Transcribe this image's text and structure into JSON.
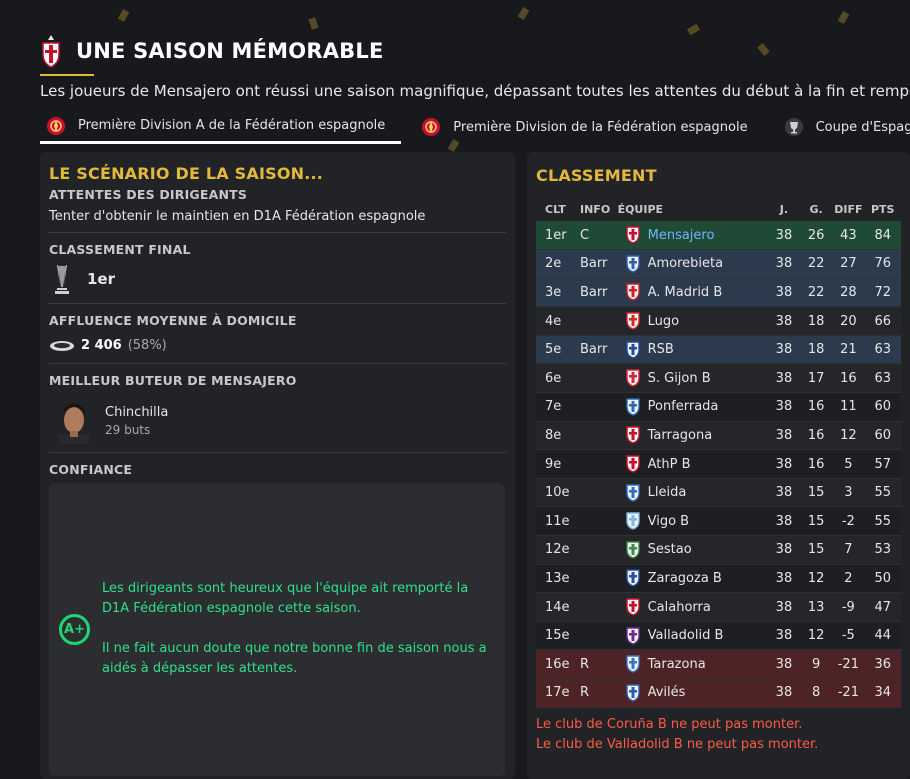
{
  "header": {
    "title": "UNE SAISON MÉMORABLE",
    "subtitle": "Les joueurs de Mensajero ont réussi une saison magnifique, dépassant toutes les attentes du début à la fin et remporté"
  },
  "tabs": [
    {
      "label": "Première Division A de la Fédération espagnole",
      "icon": "league-badge-icon",
      "active": true
    },
    {
      "label": "Première Division de la Fédération espagnole",
      "icon": "league-badge-icon",
      "active": false
    },
    {
      "label": "Coupe d'Espagne",
      "icon": "cup-icon",
      "active": false
    }
  ],
  "scenario": {
    "title": "LE SCÉNARIO DE LA SAISON...",
    "target_label": "ATTENTES DES DIRIGEANTS",
    "target_value": "Tenter d'obtenir le maintien en D1A Fédération espagnole",
    "final_label": "CLASSEMENT FINAL",
    "final_value": "1er",
    "attendance_label": "AFFLUENCE MOYENNE À DOMICILE",
    "attendance_value": "2 406",
    "attendance_pct": "(58%)",
    "scorer_label": "MEILLEUR BUTEUR DE MENSAJERO",
    "scorer_name": "Chinchilla",
    "scorer_goals": "29 buts",
    "confidence_label": "CONFIANCE",
    "confidence_grade": "A+",
    "confidence_text_1": "Les dirigeants sont heureux que l'équipe ait remporté la D1A Fédération espagnole cette saison.",
    "confidence_text_2": "Il ne fait aucun doute que notre bonne fin de saison nous a aidés à dépasser les attentes."
  },
  "standings": {
    "title": "CLASSEMENT",
    "columns": {
      "pos": "CLT",
      "info": "INFO",
      "team": "ÉQUIPE",
      "played": "J.",
      "goals": "G.",
      "diff": "DIFF",
      "pts": "PTS"
    },
    "rows": [
      {
        "pos": "1er",
        "info": "C",
        "team": "Mensajero",
        "played": "38",
        "won": "26",
        "diff": "43",
        "pts": "84",
        "style": "champ",
        "crest_color": "#c8102e",
        "me": true
      },
      {
        "pos": "2e",
        "info": "Barr",
        "team": "Amorebieta",
        "played": "38",
        "won": "22",
        "diff": "27",
        "pts": "76",
        "style": "promo",
        "crest_color": "#2e5fb3"
      },
      {
        "pos": "3e",
        "info": "Barr",
        "team": "A. Madrid B",
        "played": "38",
        "won": "22",
        "diff": "28",
        "pts": "72",
        "style": "promo",
        "crest_color": "#d0202a"
      },
      {
        "pos": "4e",
        "info": "",
        "team": "Lugo",
        "played": "38",
        "won": "18",
        "diff": "20",
        "pts": "66",
        "style": "alt",
        "crest_color": "#d62828"
      },
      {
        "pos": "5e",
        "info": "Barr",
        "team": "RSB",
        "played": "38",
        "won": "18",
        "diff": "21",
        "pts": "63",
        "style": "promo",
        "crest_color": "#1d4d9c"
      },
      {
        "pos": "6e",
        "info": "",
        "team": "S. Gijon B",
        "played": "38",
        "won": "17",
        "diff": "16",
        "pts": "63",
        "style": "alt",
        "crest_color": "#d7263d"
      },
      {
        "pos": "7e",
        "info": "",
        "team": "Ponferrada",
        "played": "38",
        "won": "16",
        "diff": "11",
        "pts": "60",
        "style": "plain",
        "crest_color": "#2d6ab8"
      },
      {
        "pos": "8e",
        "info": "",
        "team": "Tarragona",
        "played": "38",
        "won": "16",
        "diff": "12",
        "pts": "60",
        "style": "alt",
        "crest_color": "#c8102e"
      },
      {
        "pos": "9e",
        "info": "",
        "team": "AthP B",
        "played": "38",
        "won": "16",
        "diff": "5",
        "pts": "57",
        "style": "plain",
        "crest_color": "#c8102e"
      },
      {
        "pos": "10e",
        "info": "",
        "team": "Lleida",
        "played": "38",
        "won": "15",
        "diff": "3",
        "pts": "55",
        "style": "alt",
        "crest_color": "#2f6fc2"
      },
      {
        "pos": "11e",
        "info": "",
        "team": "Vigo B",
        "played": "38",
        "won": "15",
        "diff": "-2",
        "pts": "55",
        "style": "plain",
        "crest_color": "#7ab8e6"
      },
      {
        "pos": "12e",
        "info": "",
        "team": "Sestao",
        "played": "38",
        "won": "15",
        "diff": "7",
        "pts": "53",
        "style": "alt",
        "crest_color": "#3a8a4a"
      },
      {
        "pos": "13e",
        "info": "",
        "team": "Zaragoza B",
        "played": "38",
        "won": "12",
        "diff": "2",
        "pts": "50",
        "style": "plain",
        "crest_color": "#2250a8"
      },
      {
        "pos": "14e",
        "info": "",
        "team": "Calahorra",
        "played": "38",
        "won": "13",
        "diff": "-9",
        "pts": "47",
        "style": "alt",
        "crest_color": "#c8102e"
      },
      {
        "pos": "15e",
        "info": "",
        "team": "Valladolid B",
        "played": "38",
        "won": "12",
        "diff": "-5",
        "pts": "44",
        "style": "plain",
        "crest_color": "#6b2d8f"
      },
      {
        "pos": "16e",
        "info": "R",
        "team": "Tarazona",
        "played": "38",
        "won": "9",
        "diff": "-21",
        "pts": "36",
        "style": "releg",
        "crest_color": "#3a73c8"
      },
      {
        "pos": "17e",
        "info": "R",
        "team": "Avilés",
        "played": "38",
        "won": "8",
        "diff": "-21",
        "pts": "34",
        "style": "releg",
        "crest_color": "#2d5fb0"
      }
    ],
    "notes": [
      "Le club de Coruña B ne peut pas monter.",
      "Le club de Valladolid B ne peut pas monter."
    ]
  },
  "colors": {
    "accent": "#e2b93b",
    "champion_row": "#1f4a35",
    "promotion_row": "#2c3a4e",
    "relegation_row": "#4d2326",
    "confidence": "#1fd676",
    "warning": "#ff5a46"
  }
}
